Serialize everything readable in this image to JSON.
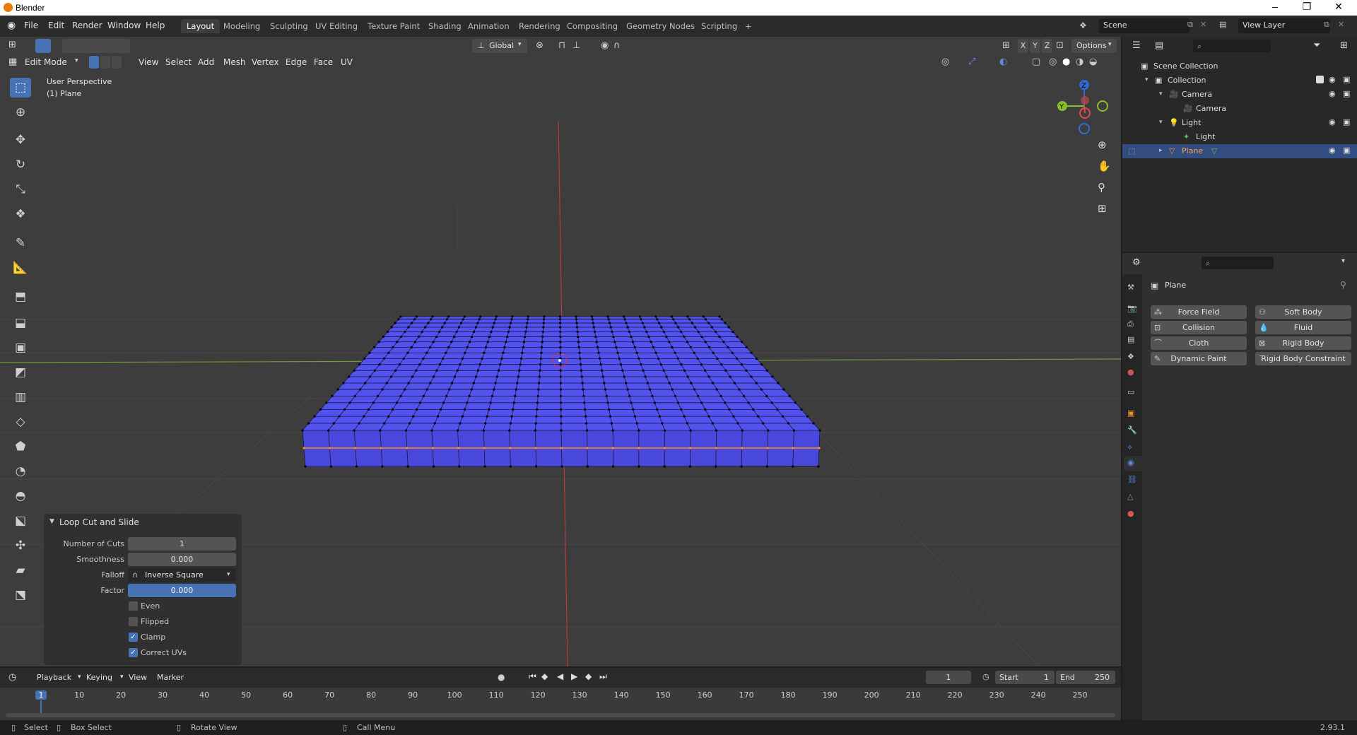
{
  "window": {
    "title": "Blender"
  },
  "menus": [
    "File",
    "Edit",
    "Render",
    "Window",
    "Help"
  ],
  "workspaces": [
    "Layout",
    "Modeling",
    "Sculpting",
    "UV Editing",
    "Texture Paint",
    "Shading",
    "Animation",
    "Rendering",
    "Compositing",
    "Geometry Nodes",
    "Scripting",
    "+"
  ],
  "scene": {
    "name": "Scene",
    "view_layer": "View Layer"
  },
  "viewport_header": {
    "transform_orientation": "Global",
    "axes": [
      "X",
      "Y",
      "Z"
    ],
    "options_label": "Options",
    "mode": "Edit Mode",
    "menus": [
      "View",
      "Select",
      "Add",
      "Mesh",
      "Vertex",
      "Edge",
      "Face",
      "UV"
    ]
  },
  "viewport": {
    "view_name": "User Perspective",
    "object_label": "(1) Plane",
    "mesh_color": "#5252ee",
    "grid_color": "#4a4a4a",
    "x_axis_color": "#6f9c33",
    "y_axis_color": "#b83a3a",
    "selected_edge_color": "#ff8c1a"
  },
  "operator_panel": {
    "title": "Loop Cut and Slide",
    "fields": [
      {
        "label": "Number of Cuts",
        "value": "1"
      },
      {
        "label": "Smoothness",
        "value": "0.000"
      },
      {
        "label": "Falloff",
        "value": "Inverse Square"
      },
      {
        "label": "Factor",
        "value": "0.000"
      }
    ],
    "checkboxes": [
      {
        "label": "Even",
        "checked": false
      },
      {
        "label": "Flipped",
        "checked": false
      },
      {
        "label": "Clamp",
        "checked": true
      },
      {
        "label": "Correct UVs",
        "checked": true
      }
    ]
  },
  "timeline": {
    "menus": [
      "Playback",
      "Keying",
      "View",
      "Marker"
    ],
    "current_frame": "1",
    "start_label": "Start",
    "start": "1",
    "end_label": "End",
    "end": "250",
    "ticks": [
      "1",
      "10",
      "20",
      "30",
      "40",
      "50",
      "60",
      "70",
      "80",
      "90",
      "100",
      "110",
      "120",
      "130",
      "140",
      "150",
      "160",
      "170",
      "180",
      "190",
      "200",
      "210",
      "220",
      "230",
      "240",
      "250"
    ]
  },
  "statusbar": {
    "items": [
      "Select",
      "Box Select",
      "Rotate View",
      "Call Menu"
    ],
    "version": "2.93.1"
  },
  "outliner": {
    "rows": [
      {
        "label": "Scene Collection",
        "indent": 0,
        "icon": "scene-collection-icon"
      },
      {
        "label": "Collection",
        "indent": 1,
        "icon": "collection-icon"
      },
      {
        "label": "Camera",
        "indent": 2,
        "icon": "camera-object-icon"
      },
      {
        "label": "Camera",
        "indent": 3,
        "icon": "camera-data-icon"
      },
      {
        "label": "Light",
        "indent": 2,
        "icon": "light-object-icon"
      },
      {
        "label": "Light",
        "indent": 3,
        "icon": "light-data-icon"
      },
      {
        "label": "Plane",
        "indent": 2,
        "icon": "mesh-object-icon",
        "selected": true
      }
    ]
  },
  "properties": {
    "object_name": "Plane",
    "physics_buttons": [
      {
        "label": "Force Field",
        "col": 0
      },
      {
        "label": "Soft Body",
        "col": 1
      },
      {
        "label": "Collision",
        "col": 0
      },
      {
        "label": "Fluid",
        "col": 1
      },
      {
        "label": "Cloth",
        "col": 0
      },
      {
        "label": "Rigid Body",
        "col": 1
      },
      {
        "label": "Dynamic Paint",
        "col": 0
      },
      {
        "label": "Rigid Body Constraint",
        "col": 1
      }
    ]
  }
}
